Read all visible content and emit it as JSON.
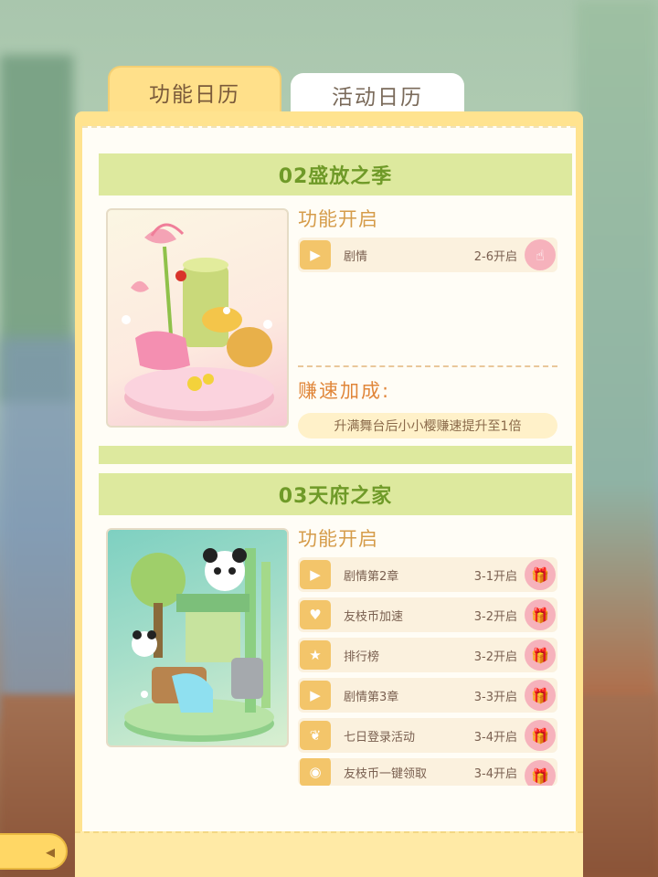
{
  "tabs": {
    "active_label": "功能日历",
    "inactive_label": "活动日历"
  },
  "sections": [
    {
      "title": "02盛放之季",
      "features_label": "功能开启",
      "features": [
        {
          "icon": "camera-icon",
          "name": "剧情",
          "time": "2-6开启"
        }
      ],
      "speed_label": "赚速加成:",
      "speed_text": "升满舞台后小小樱赚速提升至1倍"
    },
    {
      "title": "03天府之家",
      "features_label": "功能开启",
      "features": [
        {
          "icon": "camera-icon",
          "name": "剧情第2章",
          "time": "3-1开启"
        },
        {
          "icon": "coin-icon",
          "name": "友枝币加速",
          "time": "3-2开启"
        },
        {
          "icon": "trophy-icon",
          "name": "排行榜",
          "time": "3-2开启"
        },
        {
          "icon": "camera-icon",
          "name": "剧情第3章",
          "time": "3-3开启"
        },
        {
          "icon": "leaf-icon",
          "name": "七日登录活动",
          "time": "3-4开启"
        },
        {
          "icon": "money-bag-icon",
          "name": "友枝币一键领取",
          "time": "3-4开启"
        }
      ]
    }
  ],
  "colors": {
    "tab_active": "#ffe08a",
    "section_header": "#dde99e",
    "section_title": "#6f9a28",
    "label_orange": "#d59c4a",
    "gift_pink": "#f6b2bc"
  }
}
